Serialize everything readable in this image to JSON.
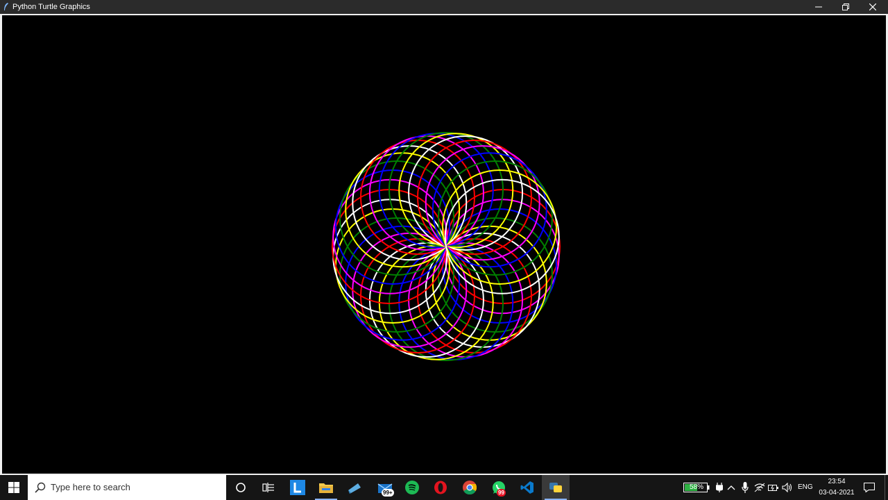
{
  "window": {
    "title": "Python Turtle Graphics",
    "controls": {
      "minimize_icon": "minimize-icon",
      "maximize_icon": "restore-icon",
      "close_icon": "close-icon"
    }
  },
  "canvas": {
    "background": "#000000",
    "drawing": {
      "type": "spirograph",
      "colors": [
        "#ff0000",
        "#ff00ff",
        "#0000ff",
        "#008000",
        "#ffff00",
        "#ffffff"
      ]
    }
  },
  "taskbar": {
    "search_placeholder": "Type here to search",
    "pinned_apps": [
      {
        "name": "Launcher",
        "icon": "launcher-icon"
      },
      {
        "name": "File Explorer",
        "icon": "folder-icon"
      },
      {
        "name": "Remote Desktop",
        "icon": "remote-icon"
      },
      {
        "name": "Mail",
        "icon": "mail-icon",
        "badge": "99+"
      },
      {
        "name": "Spotify",
        "icon": "spotify-icon"
      },
      {
        "name": "Opera",
        "icon": "opera-icon"
      },
      {
        "name": "Chrome",
        "icon": "chrome-icon"
      },
      {
        "name": "WhatsApp",
        "icon": "whatsapp-icon",
        "badge": "99"
      },
      {
        "name": "VS Code",
        "icon": "vscode-icon"
      },
      {
        "name": "Python",
        "icon": "python-icon"
      }
    ],
    "tray": {
      "battery_percent": "58%",
      "language": "ENG",
      "time": "23:54",
      "date": "03-04-2021"
    }
  }
}
